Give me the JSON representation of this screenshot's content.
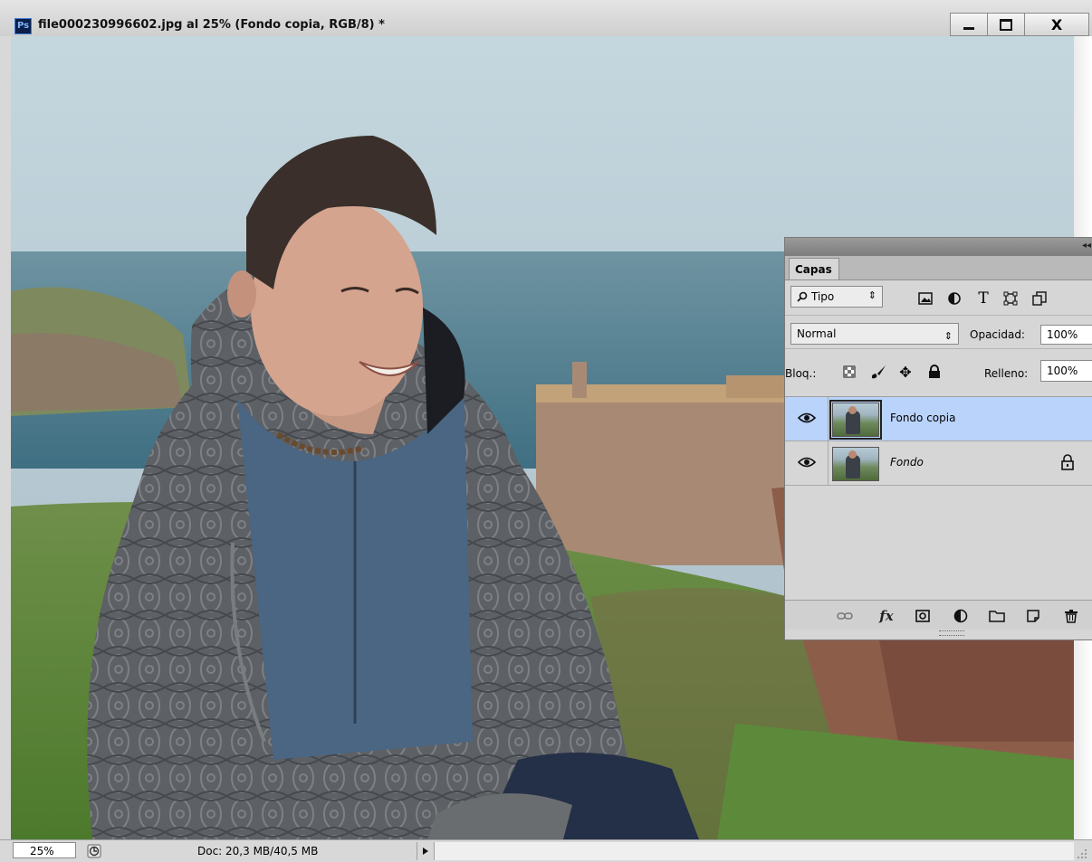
{
  "window": {
    "app_icon": "Ps",
    "title": "file000230996602.jpg al 25% (Fondo copia, RGB/8) *",
    "controls": {
      "minimize": "minimize-icon",
      "maximize": "maximize-icon",
      "close_label": "X"
    }
  },
  "statusbar": {
    "zoom": "25%",
    "doc_info": "Doc: 20,3 MB/40,5 MB"
  },
  "layers_panel": {
    "tab_label": "Capas",
    "filter_kind": "Tipo",
    "filter_icons": [
      "image-filter-icon",
      "adjustment-filter-icon",
      "type-filter-icon",
      "shape-filter-icon",
      "smart-object-filter-icon"
    ],
    "blend_mode": "Normal",
    "opacity_label": "Opacidad:",
    "opacity_value": "100%",
    "lock_label": "Bloq.:",
    "lock_icons": [
      "lock-transparent-icon",
      "lock-brush-icon",
      "lock-move-icon",
      "lock-all-icon"
    ],
    "fill_label": "Relleno:",
    "fill_value": "100%",
    "layers": [
      {
        "name": "Fondo copia",
        "selected": true,
        "visible": true,
        "locked": false,
        "italic": false
      },
      {
        "name": "Fondo",
        "selected": false,
        "visible": true,
        "locked": true,
        "italic": true
      }
    ],
    "footer_icons": [
      "link-icon",
      "fx-icon",
      "mask-icon",
      "adjustment-icon",
      "folder-icon",
      "new-layer-icon",
      "trash-icon"
    ],
    "fx_label": "fx"
  },
  "colors": {
    "selected_layer": "#b9d3fb",
    "panel_bg": "#d6d6d6"
  }
}
